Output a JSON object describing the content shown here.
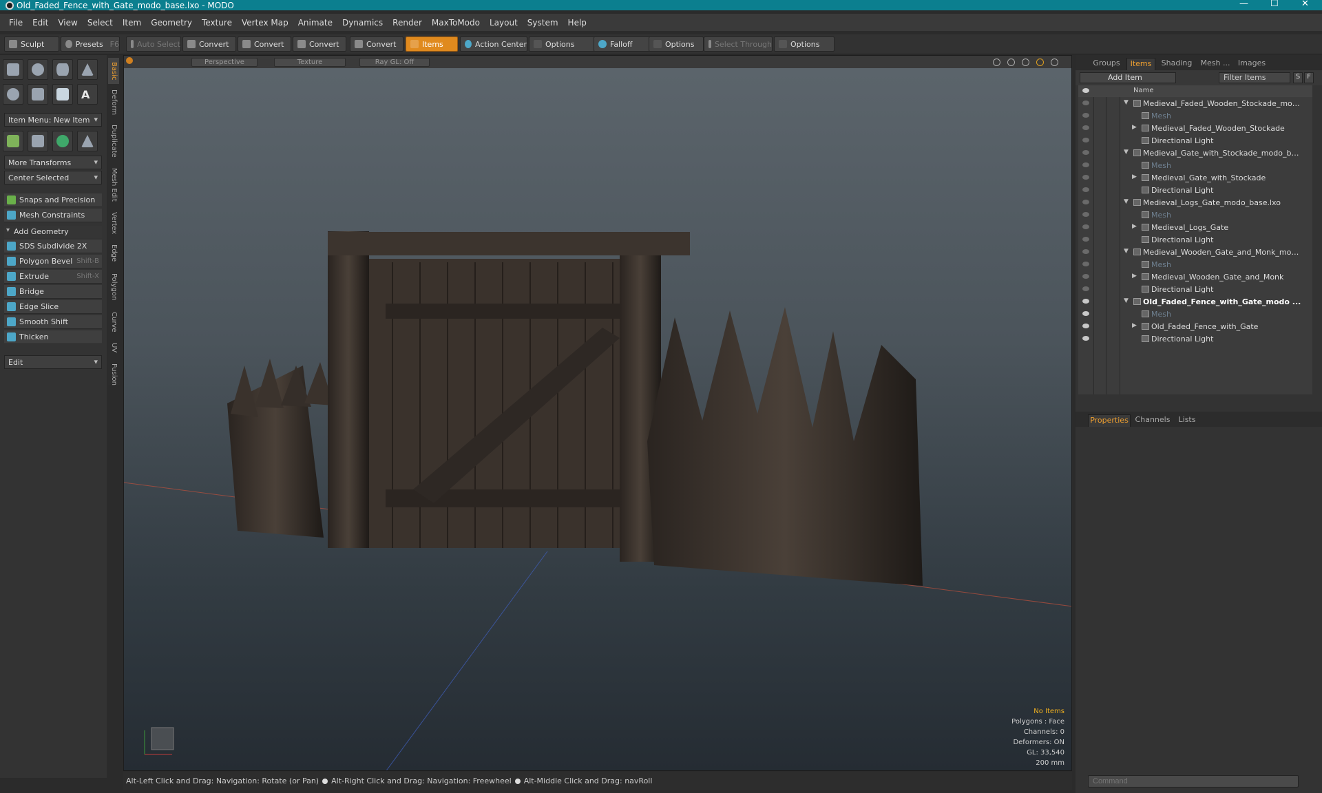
{
  "window": {
    "title": "Old_Faded_Fence_with_Gate_modo_base.lxo - MODO",
    "controls": [
      "—",
      "☐",
      "✕"
    ]
  },
  "menu": [
    "File",
    "Edit",
    "View",
    "Select",
    "Item",
    "Geometry",
    "Texture",
    "Vertex Map",
    "Animate",
    "Dynamics",
    "Render",
    "MaxToModo",
    "Layout",
    "System",
    "Help"
  ],
  "toolbar": {
    "sculpt": "Sculpt",
    "presets": "Presets",
    "presets_key": "F6",
    "auto_select": "Auto Select",
    "convert": "Convert",
    "items": "Items",
    "action_center": "Action Center",
    "options": "Options",
    "falloff": "Falloff",
    "select_through": "Select Through"
  },
  "left": {
    "item_menu": "Item Menu: New Item",
    "more_transforms": "More Transforms",
    "center_selected": "Center Selected",
    "snaps": "Snaps and Precision",
    "mesh_constraints": "Mesh Constraints",
    "add_geometry": "Add Geometry",
    "tools": [
      {
        "label": "SDS Subdivide 2X",
        "shortcut": ""
      },
      {
        "label": "Polygon Bevel",
        "shortcut": "Shift-B"
      },
      {
        "label": "Extrude",
        "shortcut": "Shift-X"
      },
      {
        "label": "Bridge",
        "shortcut": ""
      },
      {
        "label": "Edge Slice",
        "shortcut": ""
      },
      {
        "label": "Smooth Shift",
        "shortcut": ""
      },
      {
        "label": "Thicken",
        "shortcut": ""
      }
    ],
    "edit": "Edit",
    "vtabs": [
      "Basic",
      "Deform",
      "Duplicate",
      "Mesh Edit",
      "Vertex",
      "Edge",
      "Polygon",
      "Curve",
      "UV",
      "Fusion"
    ]
  },
  "viewport": {
    "perspective": "Perspective",
    "texture": "Texture",
    "raygl": "Ray GL: Off",
    "info": {
      "no_items": "No Items",
      "polygons": "Polygons : Face",
      "channels": "Channels: 0",
      "deformers": "Deformers: ON",
      "gl": "GL: 33,540",
      "scale": "200 mm"
    }
  },
  "status": {
    "hint1": "Alt-Left Click and Drag: Navigation: Rotate (or Pan)",
    "hint2": "Alt-Right Click and Drag: Navigation: Freewheel",
    "hint3": "Alt-Middle Click and Drag: navRoll"
  },
  "right": {
    "tabs": [
      "Groups",
      "Items",
      "Shading",
      "Mesh ...",
      "Images"
    ],
    "add_item": "Add Item",
    "filter_items": "Filter Items",
    "s": "S",
    "f": "F",
    "name_col": "Name",
    "tree": [
      {
        "label": "Medieval_Faded_Wooden_Stockade_modo ...",
        "level": 0,
        "type": "scene",
        "eye": false
      },
      {
        "label": "Mesh",
        "level": 1,
        "type": "mesh",
        "eye": false,
        "dim": true
      },
      {
        "label": "Medieval_Faded_Wooden_Stockade",
        "level": 1,
        "type": "group",
        "eye": false
      },
      {
        "label": "Directional Light",
        "level": 1,
        "type": "light",
        "eye": false
      },
      {
        "label": "Medieval_Gate_with_Stockade_modo_bas ...",
        "level": 0,
        "type": "scene",
        "eye": false
      },
      {
        "label": "Mesh",
        "level": 1,
        "type": "mesh",
        "eye": false,
        "dim": true
      },
      {
        "label": "Medieval_Gate_with_Stockade",
        "level": 1,
        "type": "group",
        "eye": false
      },
      {
        "label": "Directional Light",
        "level": 1,
        "type": "light",
        "eye": false
      },
      {
        "label": "Medieval_Logs_Gate_modo_base.lxo",
        "level": 0,
        "type": "scene",
        "eye": false
      },
      {
        "label": "Mesh",
        "level": 1,
        "type": "mesh",
        "eye": false,
        "dim": true
      },
      {
        "label": "Medieval_Logs_Gate",
        "level": 1,
        "type": "group",
        "eye": false
      },
      {
        "label": "Directional Light",
        "level": 1,
        "type": "light",
        "eye": false
      },
      {
        "label": "Medieval_Wooden_Gate_and_Monk_modo ...",
        "level": 0,
        "type": "scene",
        "eye": false
      },
      {
        "label": "Mesh",
        "level": 1,
        "type": "mesh",
        "eye": false,
        "dim": true
      },
      {
        "label": "Medieval_Wooden_Gate_and_Monk",
        "level": 1,
        "type": "group",
        "eye": false
      },
      {
        "label": "Directional Light",
        "level": 1,
        "type": "light",
        "eye": false
      },
      {
        "label": "Old_Faded_Fence_with_Gate_modo ...",
        "level": 0,
        "type": "scene",
        "eye": true,
        "bold": true
      },
      {
        "label": "Mesh",
        "level": 1,
        "type": "mesh",
        "eye": true,
        "dim": true
      },
      {
        "label": "Old_Faded_Fence_with_Gate",
        "level": 1,
        "type": "group",
        "eye": true
      },
      {
        "label": "Directional Light",
        "level": 1,
        "type": "light",
        "eye": true
      }
    ],
    "prop_tabs": [
      "Properties",
      "Channels",
      "Lists"
    ],
    "command_placeholder": "Command"
  },
  "colors": {
    "accent": "#f0a030",
    "titlebar": "#0b7f8f"
  }
}
